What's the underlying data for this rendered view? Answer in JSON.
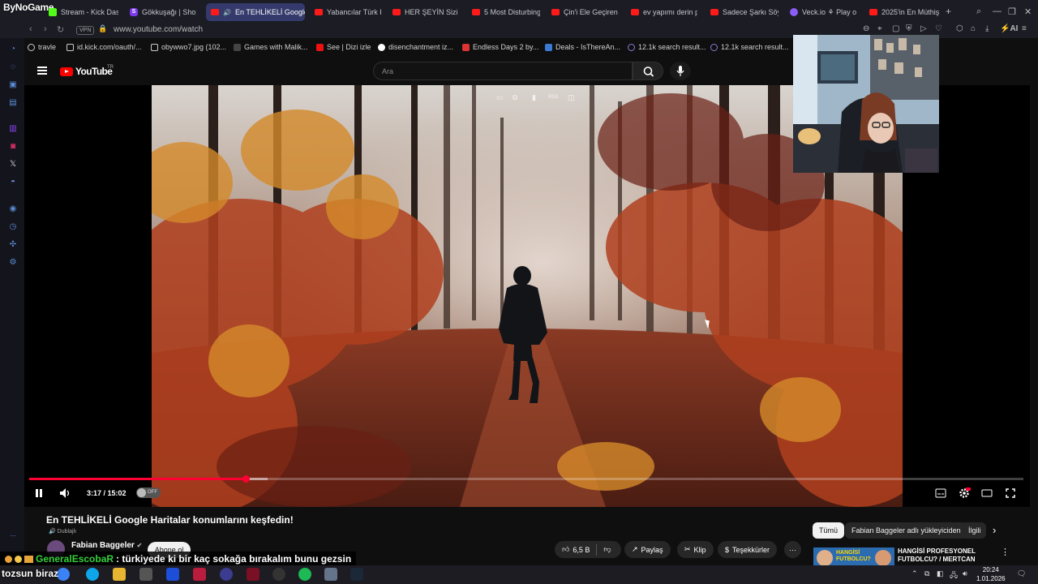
{
  "overlay": {
    "brand": "ByNoGame"
  },
  "browser": {
    "tabs": [
      {
        "label": "Stream - Kick Das",
        "icon": "kick-icon",
        "active": false
      },
      {
        "label": "Gökkuşağı | Shop",
        "icon": "s-icon",
        "active": false
      },
      {
        "label": "En TEHLİKELİ Google",
        "icon": "youtube-icon",
        "active": true
      },
      {
        "label": "Yabancılar Türk K",
        "icon": "youtube-icon",
        "active": false
      },
      {
        "label": "HER ŞEYİN Sizi Ö",
        "icon": "youtube-icon",
        "active": false
      },
      {
        "label": "5 Most Disturbing",
        "icon": "youtube-icon",
        "active": false
      },
      {
        "label": "Çin'i Ele Geçiren",
        "icon": "youtube-icon",
        "active": false
      },
      {
        "label": "ev yapımı derin p",
        "icon": "youtube-icon",
        "active": false
      },
      {
        "label": "Sadece Şarkı Söy",
        "icon": "youtube-icon",
        "active": false
      },
      {
        "label": "Veck.io ⚘ Play o",
        "icon": "veck-icon",
        "active": false
      },
      {
        "label": "2025'in En Müthiş",
        "icon": "youtube-icon",
        "active": false
      }
    ],
    "new_tab": "+",
    "vpn": "VPN",
    "url": "www.youtube.com/watch",
    "ai_label": "AI",
    "bookmarks": [
      {
        "label": "travle"
      },
      {
        "label": "id.kick.com/oauth/..."
      },
      {
        "label": "obywwo7.jpg (102..."
      },
      {
        "label": "Games with Malik..."
      },
      {
        "label": "See | Dizi izle"
      },
      {
        "label": "disenchantment iz..."
      },
      {
        "label": "Endless Days 2 by..."
      },
      {
        "label": "Deals - IsThereAn..."
      },
      {
        "label": "12.1k search result..."
      },
      {
        "label": "12.1k search result..."
      }
    ]
  },
  "youtube": {
    "logo_text": "YouTube",
    "region": "TR",
    "search_placeholder": "Ara",
    "player": {
      "time": "3:17 / 15:02",
      "progress_fraction": 0.218,
      "buffer_fraction": 0.24,
      "autoplay": "OFF"
    },
    "video": {
      "title": "En TEHLİKELİ Google Haritalar konumlarını keşfedin!",
      "dub_label": "Dublajlı",
      "channel": "Fabian Baggeler",
      "subscribe": "Abone ol",
      "likes": "6,5 B",
      "share": "Paylaş",
      "clip": "Klip",
      "thanks": "Teşekkürler",
      "more": "···"
    },
    "chips": [
      {
        "label": "Tümü",
        "selected": true
      },
      {
        "label": "Fabian Baggeler adlı yükleyiciden",
        "selected": false
      },
      {
        "label": "İlgili",
        "selected": false
      }
    ],
    "recommendation": {
      "title": "HANGİSİ PROFESYONEL FUTBOLCU? / MERTCAN",
      "thumb_text": "HANGİSİ FUTBOLCU?"
    }
  },
  "stream_chat": {
    "user": "GeneralEscobaR",
    "message": ": türkiyede ki bir kaç sokağa bırakalım bunu gezsin",
    "second_line": "tozsun biraz"
  },
  "taskbar": {
    "time": "20:24",
    "date": "1.01.2026"
  }
}
